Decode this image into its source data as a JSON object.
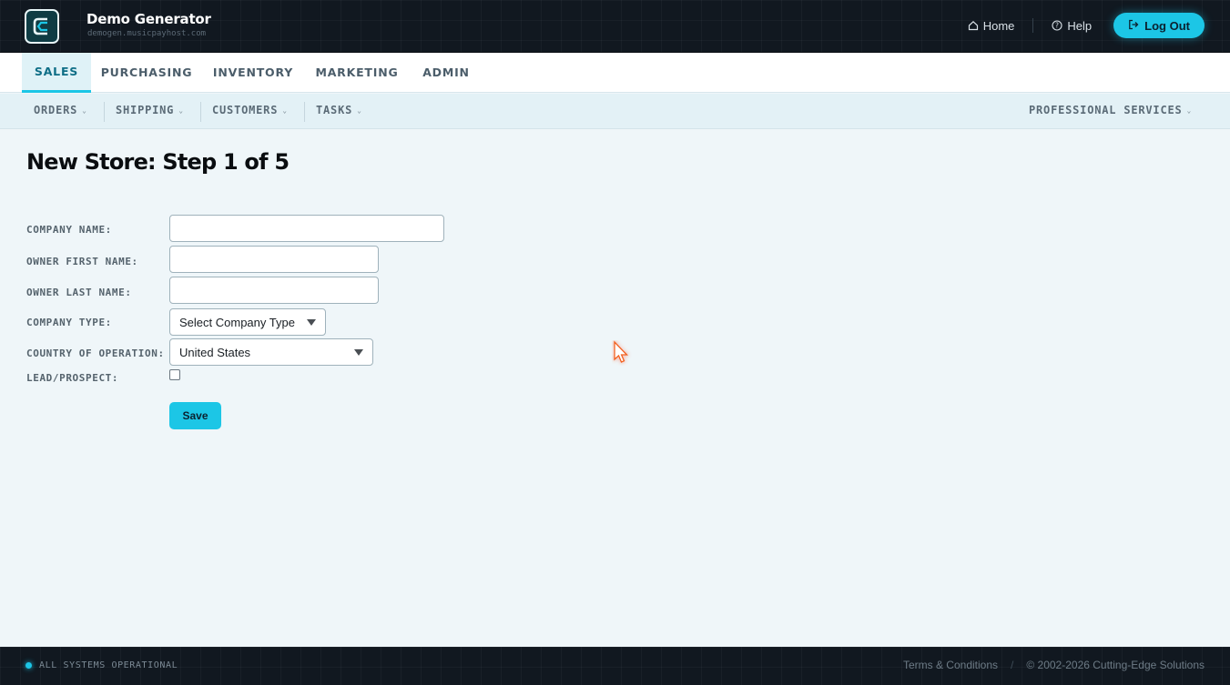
{
  "header": {
    "title": "Demo Generator",
    "subtitle": "demogen.musicpayhost.com",
    "home_label": "Home",
    "help_label": "Help",
    "logout_label": "Log Out"
  },
  "main_nav": {
    "tabs": [
      {
        "label": "SALES",
        "active": true
      },
      {
        "label": "PURCHASING"
      },
      {
        "label": "INVENTORY"
      },
      {
        "label": "MARKETING"
      },
      {
        "label": "ADMIN"
      }
    ]
  },
  "sub_nav": {
    "items": [
      {
        "label": "ORDERS"
      },
      {
        "label": "SHIPPING"
      },
      {
        "label": "CUSTOMERS"
      },
      {
        "label": "TASKS"
      }
    ],
    "right_item": {
      "label": "PROFESSIONAL SERVICES"
    }
  },
  "page": {
    "title": "New Store: Step 1 of 5"
  },
  "form": {
    "company_name": {
      "label": "COMPANY NAME:",
      "value": ""
    },
    "owner_first_name": {
      "label": "OWNER FIRST NAME:",
      "value": ""
    },
    "owner_last_name": {
      "label": "OWNER LAST NAME:",
      "value": ""
    },
    "company_type": {
      "label": "COMPANY TYPE:",
      "selected": "Select Company Type"
    },
    "country": {
      "label": "COUNTRY OF OPERATION:",
      "selected": "United States"
    },
    "lead_prospect": {
      "label": "LEAD/PROSPECT:",
      "checked": false
    },
    "save_label": "Save"
  },
  "footer": {
    "status": "ALL SYSTEMS OPERATIONAL",
    "terms": "Terms & Conditions",
    "separator": "/",
    "copyright": "© 2002-2026 Cutting-Edge Solutions"
  },
  "colors": {
    "accent": "#1cc6e6",
    "header_bg": "#111820",
    "page_bg": "#eff6f9"
  }
}
